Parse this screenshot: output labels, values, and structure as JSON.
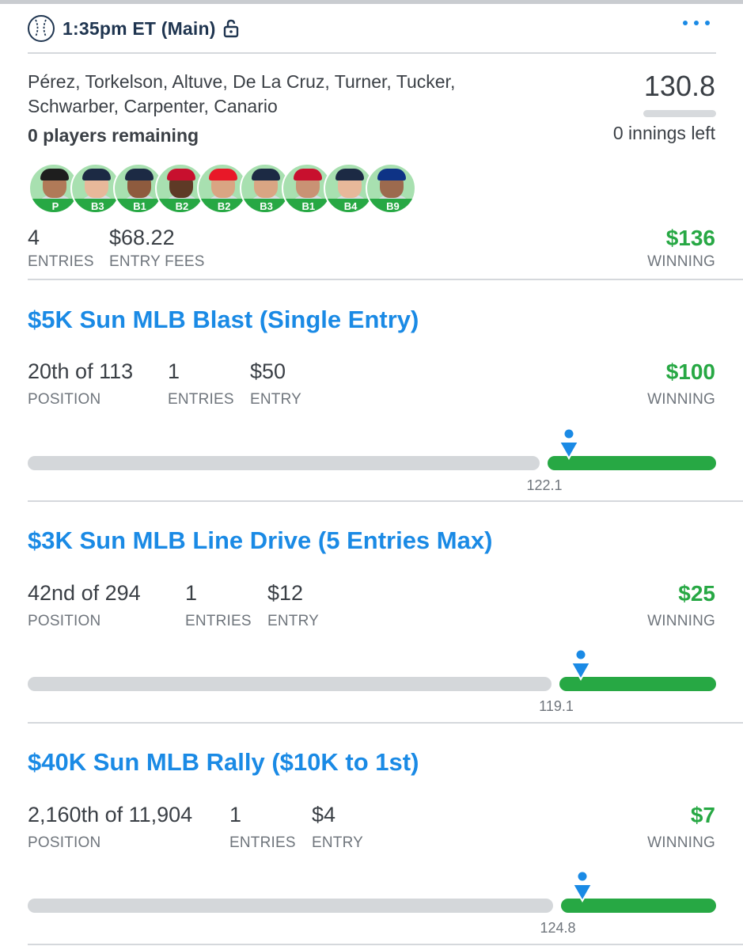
{
  "header": {
    "title": "1:35pm ET (Main)",
    "icons": [
      "baseball-icon",
      "lock-open-icon",
      "more-icon"
    ]
  },
  "lineup": {
    "players_text": "Pérez, Torkelson, Altuve, De La Cruz, Turner, Tucker, Schwarber, Carpenter, Canario",
    "remaining": "0 players remaining",
    "score": "130.8",
    "innings_left": "0 innings left",
    "positions": [
      "P",
      "B3",
      "B1",
      "B2",
      "B2",
      "B3",
      "B1",
      "B4",
      "B9"
    ],
    "entries_value": "4",
    "entries_label": "ENTRIES",
    "fees_value": "$68.22",
    "fees_label": "ENTRY FEES",
    "winning_value": "$136",
    "winning_label": "WINNING"
  },
  "contests": [
    {
      "title": "$5K Sun MLB Blast (Single Entry)",
      "position_value": "20th of 113",
      "position_label": "POSITION",
      "entries_value": "1",
      "entries_label": "ENTRIES",
      "entry_value": "$50",
      "entry_label": "ENTRY",
      "winning_value": "$100",
      "winning_label": "WINNING",
      "cutline_score": "122.1",
      "cutline_fraction": 0.75
    },
    {
      "title": "$3K Sun MLB Line Drive (5 Entries Max)",
      "position_value": "42nd of 294",
      "position_label": "POSITION",
      "entries_value": "1",
      "entries_label": "ENTRIES",
      "entry_value": "$12",
      "entry_label": "ENTRY",
      "winning_value": "$25",
      "winning_label": "WINNING",
      "cutline_score": "119.1",
      "cutline_fraction": 0.768
    },
    {
      "title": "$40K Sun MLB Rally ($10K to 1st)",
      "position_value": "2,160th of 11,904",
      "position_label": "POSITION",
      "entries_value": "1",
      "entries_label": "ENTRIES",
      "entry_value": "$4",
      "entry_label": "ENTRY",
      "winning_value": "$7",
      "winning_label": "WINNING",
      "cutline_score": "124.8",
      "cutline_fraction": 0.77
    }
  ],
  "colors": {
    "accent_blue": "#1a8ae5",
    "winning_green": "#27a844",
    "navy": "#1f3550",
    "track_grey": "#d4d7da"
  }
}
